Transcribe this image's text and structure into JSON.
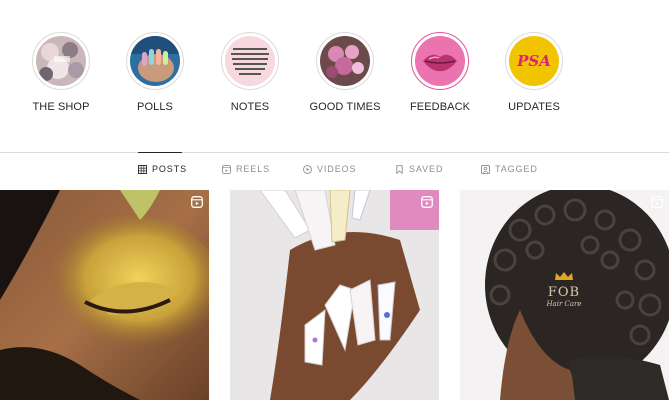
{
  "highlights": [
    {
      "label": "THE SHOP",
      "icon": "shop-collage-thumbnail"
    },
    {
      "label": "POLLS",
      "icon": "manicure-thumbnail"
    },
    {
      "label": "NOTES",
      "icon": "text-note-thumbnail"
    },
    {
      "label": "GOOD TIMES",
      "icon": "flowers-thumbnail"
    },
    {
      "label": "FEEDBACK",
      "icon": "lips-thumbnail"
    },
    {
      "label": "UPDATES",
      "icon": "psa-thumbnail",
      "badge_text": "PSA"
    }
  ],
  "tabs": [
    {
      "label": "POSTS",
      "icon": "grid-icon",
      "active": true
    },
    {
      "label": "REELS",
      "icon": "reels-icon",
      "active": false
    },
    {
      "label": "VIDEOS",
      "icon": "video-icon",
      "active": false
    },
    {
      "label": "SAVED",
      "icon": "bookmark-icon",
      "active": false
    },
    {
      "label": "TAGGED",
      "icon": "tag-person-icon",
      "active": false
    }
  ],
  "posts": [
    {
      "subject": "eye-makeup-photo",
      "badge": "reel-icon"
    },
    {
      "subject": "long-nails-photo",
      "badge": "reel-icon"
    },
    {
      "subject": "curly-hair-photo",
      "badge": "reel-icon",
      "logo_text": "FOB",
      "logo_subtext": "Hair Care"
    }
  ],
  "colors": {
    "text": "#262626",
    "muted": "#8e8e8e",
    "divider": "#dbdbdb",
    "feedback_ring": "#e8559a",
    "updates_bg": "#f2c400",
    "updates_text": "#e0217a"
  }
}
